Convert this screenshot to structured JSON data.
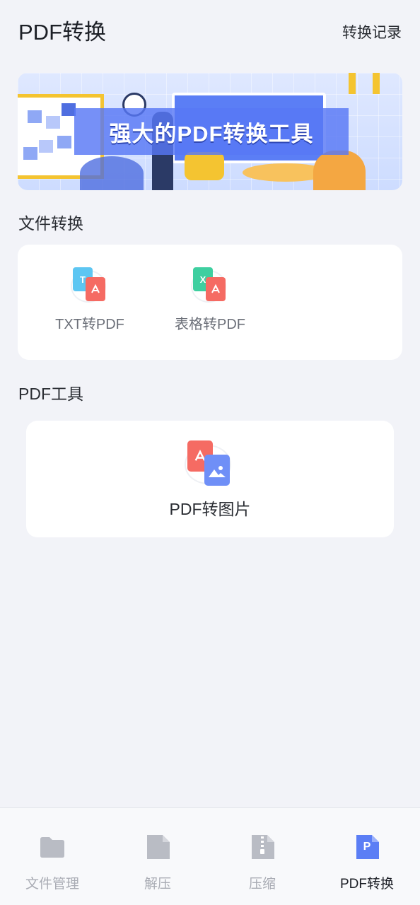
{
  "header": {
    "title": "PDF转换",
    "history_label": "转换记录"
  },
  "banner": {
    "caption": "强大的PDF转换工具"
  },
  "file_convert": {
    "section_label": "文件转换",
    "tools": [
      {
        "label": "TXT转PDF",
        "icon": "txt-to-pdf-icon",
        "badge": "T"
      },
      {
        "label": "表格转PDF",
        "icon": "sheet-to-pdf-icon",
        "badge": "X"
      }
    ]
  },
  "pdf_tools": {
    "section_label": "PDF工具",
    "tools": [
      {
        "label": "PDF转图片",
        "icon": "pdf-to-image-icon"
      }
    ]
  },
  "tabbar": {
    "tabs": [
      {
        "label": "文件管理",
        "icon": "folder-icon"
      },
      {
        "label": "解压",
        "icon": "extract-icon"
      },
      {
        "label": "压缩",
        "icon": "zip-icon"
      },
      {
        "label": "PDF转换",
        "icon": "pdf-convert-icon",
        "icon_letter": "P",
        "active": true
      }
    ]
  },
  "colors": {
    "accent": "#5b7ef5",
    "pdf_red": "#f56b63",
    "txt_blue": "#5dc6f2",
    "sheet_green": "#3ecfa0",
    "tab_inactive": "#b9bcc4"
  }
}
